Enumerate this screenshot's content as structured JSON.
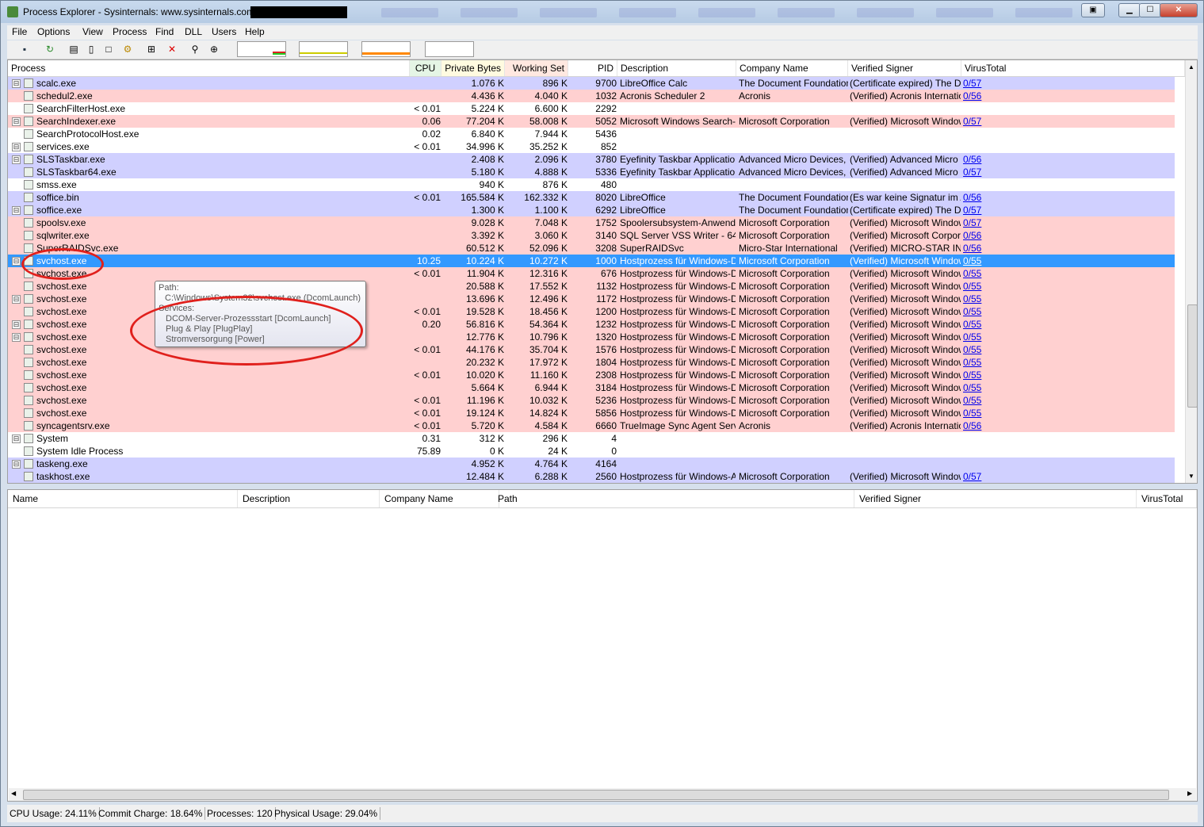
{
  "window": {
    "title": "Process Explorer - Sysinternals: www.sysinternals.com"
  },
  "menu": [
    "File",
    "Options",
    "View",
    "Process",
    "Find",
    "DLL",
    "Users",
    "Help"
  ],
  "columns": {
    "process": "Process",
    "cpu": "CPU",
    "private_bytes": "Private Bytes",
    "working_set": "Working Set",
    "pid": "PID",
    "description": "Description",
    "company": "Company Name",
    "signer": "Verified Signer",
    "virustotal": "VirusTotal"
  },
  "processes": [
    {
      "name": "scalc.exe",
      "tree": "⊟",
      "cpu": "",
      "pb": "1.076 K",
      "ws": "896 K",
      "pid": "9700",
      "desc": "LibreOffice Calc",
      "comp": "The Document Foundation",
      "signer": "(Certificate expired) The Do...",
      "vt": "0/57",
      "color": "blue"
    },
    {
      "name": "schedul2.exe",
      "tree": "",
      "cpu": "",
      "pb": "4.436 K",
      "ws": "4.040 K",
      "pid": "1032",
      "desc": "Acronis Scheduler 2",
      "comp": "Acronis",
      "signer": "(Verified) Acronis Internatio...",
      "vt": "0/56",
      "color": "pink"
    },
    {
      "name": "SearchFilterHost.exe",
      "tree": "",
      "cpu": "< 0.01",
      "pb": "5.224 K",
      "ws": "6.600 K",
      "pid": "2292",
      "desc": "",
      "comp": "",
      "signer": "",
      "vt": "",
      "color": "white"
    },
    {
      "name": "SearchIndexer.exe",
      "tree": "⊟",
      "cpu": "0.06",
      "pb": "77.204 K",
      "ws": "58.008 K",
      "pid": "5052",
      "desc": "Microsoft Windows Search-I...",
      "comp": "Microsoft Corporation",
      "signer": "(Verified) Microsoft Windows",
      "vt": "0/57",
      "color": "pink"
    },
    {
      "name": "SearchProtocolHost.exe",
      "tree": "",
      "cpu": "0.02",
      "pb": "6.840 K",
      "ws": "7.944 K",
      "pid": "5436",
      "desc": "",
      "comp": "",
      "signer": "",
      "vt": "",
      "color": "white"
    },
    {
      "name": "services.exe",
      "tree": "⊟",
      "cpu": "< 0.01",
      "pb": "34.996 K",
      "ws": "35.252 K",
      "pid": "852",
      "desc": "",
      "comp": "",
      "signer": "",
      "vt": "",
      "color": "white"
    },
    {
      "name": "SLSTaskbar.exe",
      "tree": "⊟",
      "cpu": "",
      "pb": "2.408 K",
      "ws": "2.096 K",
      "pid": "3780",
      "desc": "Eyefinity Taskbar Application",
      "comp": "Advanced Micro Devices, ...",
      "signer": "(Verified) Advanced Micro ...",
      "vt": "0/56",
      "color": "blue"
    },
    {
      "name": "SLSTaskbar64.exe",
      "tree": "",
      "cpu": "",
      "pb": "5.180 K",
      "ws": "4.888 K",
      "pid": "5336",
      "desc": "Eyefinity Taskbar Application",
      "comp": "Advanced Micro Devices, ...",
      "signer": "(Verified) Advanced Micro ...",
      "vt": "0/57",
      "color": "blue"
    },
    {
      "name": "smss.exe",
      "tree": "",
      "cpu": "",
      "pb": "940 K",
      "ws": "876 K",
      "pid": "480",
      "desc": "",
      "comp": "",
      "signer": "",
      "vt": "",
      "color": "white"
    },
    {
      "name": "soffice.bin",
      "tree": "",
      "cpu": "< 0.01",
      "pb": "165.584 K",
      "ws": "162.332 K",
      "pid": "8020",
      "desc": "LibreOffice",
      "comp": "The Document Foundation",
      "signer": "(Es war keine Signatur im A...",
      "vt": "0/56",
      "color": "blue"
    },
    {
      "name": "soffice.exe",
      "tree": "⊟",
      "cpu": "",
      "pb": "1.300 K",
      "ws": "1.100 K",
      "pid": "6292",
      "desc": "LibreOffice",
      "comp": "The Document Foundation",
      "signer": "(Certificate expired) The Do...",
      "vt": "0/57",
      "color": "blue"
    },
    {
      "name": "spoolsv.exe",
      "tree": "",
      "cpu": "",
      "pb": "9.028 K",
      "ws": "7.048 K",
      "pid": "1752",
      "desc": "Spoolersubsystem-Anwendung",
      "comp": "Microsoft Corporation",
      "signer": "(Verified) Microsoft Windows",
      "vt": "0/57",
      "color": "pink"
    },
    {
      "name": "sqlwriter.exe",
      "tree": "",
      "cpu": "",
      "pb": "3.392 K",
      "ws": "3.060 K",
      "pid": "3140",
      "desc": "SQL Server VSS Writer - 64 Bit",
      "comp": "Microsoft Corporation",
      "signer": "(Verified) Microsoft Corporat...",
      "vt": "0/56",
      "color": "pink"
    },
    {
      "name": "SuperRAIDSvc.exe",
      "tree": "",
      "cpu": "",
      "pb": "60.512 K",
      "ws": "52.096 K",
      "pid": "3208",
      "desc": "SuperRAIDSvc",
      "comp": "Micro-Star International",
      "signer": "(Verified) MICRO-STAR IN...",
      "vt": "0/56",
      "color": "pink"
    },
    {
      "name": "svchost.exe",
      "tree": "⊟",
      "cpu": "10.25",
      "pb": "10.224 K",
      "ws": "10.272 K",
      "pid": "1000",
      "desc": "Hostprozess für Windows-Di...",
      "comp": "Microsoft Corporation",
      "signer": "(Verified) Microsoft Windows",
      "vt": "0/55",
      "color": "sel"
    },
    {
      "name": "svchost.exe",
      "tree": "",
      "cpu": "< 0.01",
      "pb": "11.904 K",
      "ws": "12.316 K",
      "pid": "676",
      "desc": "Hostprozess für Windows-Di...",
      "comp": "Microsoft Corporation",
      "signer": "(Verified) Microsoft Windows",
      "vt": "0/55",
      "color": "pink"
    },
    {
      "name": "svchost.exe",
      "tree": "",
      "cpu": "",
      "pb": "20.588 K",
      "ws": "17.552 K",
      "pid": "1132",
      "desc": "Hostprozess für Windows-Di...",
      "comp": "Microsoft Corporation",
      "signer": "(Verified) Microsoft Windows",
      "vt": "0/55",
      "color": "pink"
    },
    {
      "name": "svchost.exe",
      "tree": "⊟",
      "cpu": "",
      "pb": "13.696 K",
      "ws": "12.496 K",
      "pid": "1172",
      "desc": "Hostprozess für Windows-Di...",
      "comp": "Microsoft Corporation",
      "signer": "(Verified) Microsoft Windows",
      "vt": "0/55",
      "color": "pink"
    },
    {
      "name": "svchost.exe",
      "tree": "",
      "cpu": "< 0.01",
      "pb": "19.528 K",
      "ws": "18.456 K",
      "pid": "1200",
      "desc": "Hostprozess für Windows-Di...",
      "comp": "Microsoft Corporation",
      "signer": "(Verified) Microsoft Windows",
      "vt": "0/55",
      "color": "pink"
    },
    {
      "name": "svchost.exe",
      "tree": "⊟",
      "cpu": "0.20",
      "pb": "56.816 K",
      "ws": "54.364 K",
      "pid": "1232",
      "desc": "Hostprozess für Windows-Di...",
      "comp": "Microsoft Corporation",
      "signer": "(Verified) Microsoft Windows",
      "vt": "0/55",
      "color": "pink"
    },
    {
      "name": "svchost.exe",
      "tree": "⊟",
      "cpu": "",
      "pb": "12.776 K",
      "ws": "10.796 K",
      "pid": "1320",
      "desc": "Hostprozess für Windows-Di...",
      "comp": "Microsoft Corporation",
      "signer": "(Verified) Microsoft Windows",
      "vt": "0/55",
      "color": "pink"
    },
    {
      "name": "svchost.exe",
      "tree": "",
      "cpu": "< 0.01",
      "pb": "44.176 K",
      "ws": "35.704 K",
      "pid": "1576",
      "desc": "Hostprozess für Windows-Di...",
      "comp": "Microsoft Corporation",
      "signer": "(Verified) Microsoft Windows",
      "vt": "0/55",
      "color": "pink"
    },
    {
      "name": "svchost.exe",
      "tree": "",
      "cpu": "",
      "pb": "20.232 K",
      "ws": "17.972 K",
      "pid": "1804",
      "desc": "Hostprozess für Windows-Di...",
      "comp": "Microsoft Corporation",
      "signer": "(Verified) Microsoft Windows",
      "vt": "0/55",
      "color": "pink"
    },
    {
      "name": "svchost.exe",
      "tree": "",
      "cpu": "< 0.01",
      "pb": "10.020 K",
      "ws": "11.160 K",
      "pid": "2308",
      "desc": "Hostprozess für Windows-Di...",
      "comp": "Microsoft Corporation",
      "signer": "(Verified) Microsoft Windows",
      "vt": "0/55",
      "color": "pink"
    },
    {
      "name": "svchost.exe",
      "tree": "",
      "cpu": "",
      "pb": "5.664 K",
      "ws": "6.944 K",
      "pid": "3184",
      "desc": "Hostprozess für Windows-Di...",
      "comp": "Microsoft Corporation",
      "signer": "(Verified) Microsoft Windows",
      "vt": "0/55",
      "color": "pink"
    },
    {
      "name": "svchost.exe",
      "tree": "",
      "cpu": "< 0.01",
      "pb": "11.196 K",
      "ws": "10.032 K",
      "pid": "5236",
      "desc": "Hostprozess für Windows-Di...",
      "comp": "Microsoft Corporation",
      "signer": "(Verified) Microsoft Windows",
      "vt": "0/55",
      "color": "pink"
    },
    {
      "name": "svchost.exe",
      "tree": "",
      "cpu": "< 0.01",
      "pb": "19.124 K",
      "ws": "14.824 K",
      "pid": "5856",
      "desc": "Hostprozess für Windows-Di...",
      "comp": "Microsoft Corporation",
      "signer": "(Verified) Microsoft Windows",
      "vt": "0/55",
      "color": "pink"
    },
    {
      "name": "syncagentsrv.exe",
      "tree": "",
      "cpu": "< 0.01",
      "pb": "5.720 K",
      "ws": "4.584 K",
      "pid": "6660",
      "desc": "TrueImage Sync Agent Servi...",
      "comp": "Acronis",
      "signer": "(Verified) Acronis Internatio...",
      "vt": "0/56",
      "color": "pink"
    },
    {
      "name": "System",
      "tree": "⊟",
      "cpu": "0.31",
      "pb": "312 K",
      "ws": "296 K",
      "pid": "4",
      "desc": "",
      "comp": "",
      "signer": "",
      "vt": "",
      "color": "white"
    },
    {
      "name": "System Idle Process",
      "tree": "",
      "cpu": "75.89",
      "pb": "0 K",
      "ws": "24 K",
      "pid": "0",
      "desc": "",
      "comp": "",
      "signer": "",
      "vt": "",
      "color": "white"
    },
    {
      "name": "taskeng.exe",
      "tree": "⊟",
      "cpu": "",
      "pb": "4.952 K",
      "ws": "4.764 K",
      "pid": "4164",
      "desc": "",
      "comp": "",
      "signer": "",
      "vt": "",
      "color": "blue"
    },
    {
      "name": "taskhost.exe",
      "tree": "",
      "cpu": "",
      "pb": "12.484 K",
      "ws": "6.288 K",
      "pid": "2560",
      "desc": "Hostprozess für Windows-Au...",
      "comp": "Microsoft Corporation",
      "signer": "(Verified) Microsoft Windows",
      "vt": "0/57",
      "color": "blue"
    }
  ],
  "tooltip": {
    "path_label": "Path:",
    "path": "C:\\Windows\\System32\\svchost.exe (DcomLaunch)",
    "services_label": "Services:",
    "services": [
      "DCOM-Server-Prozessstart [DcomLaunch]",
      "Plug & Play [PlugPlay]",
      "Stromversorgung [Power]"
    ]
  },
  "lower_columns": {
    "name": "Name",
    "description": "Description",
    "company": "Company Name",
    "path": "Path",
    "signer": "Verified Signer",
    "virustotal": "VirusTotal"
  },
  "status": {
    "cpu": "CPU Usage: 24.11%",
    "commit": "Commit Charge: 18.64%",
    "processes": "Processes: 120",
    "physical": "Physical Usage: 29.04%"
  }
}
